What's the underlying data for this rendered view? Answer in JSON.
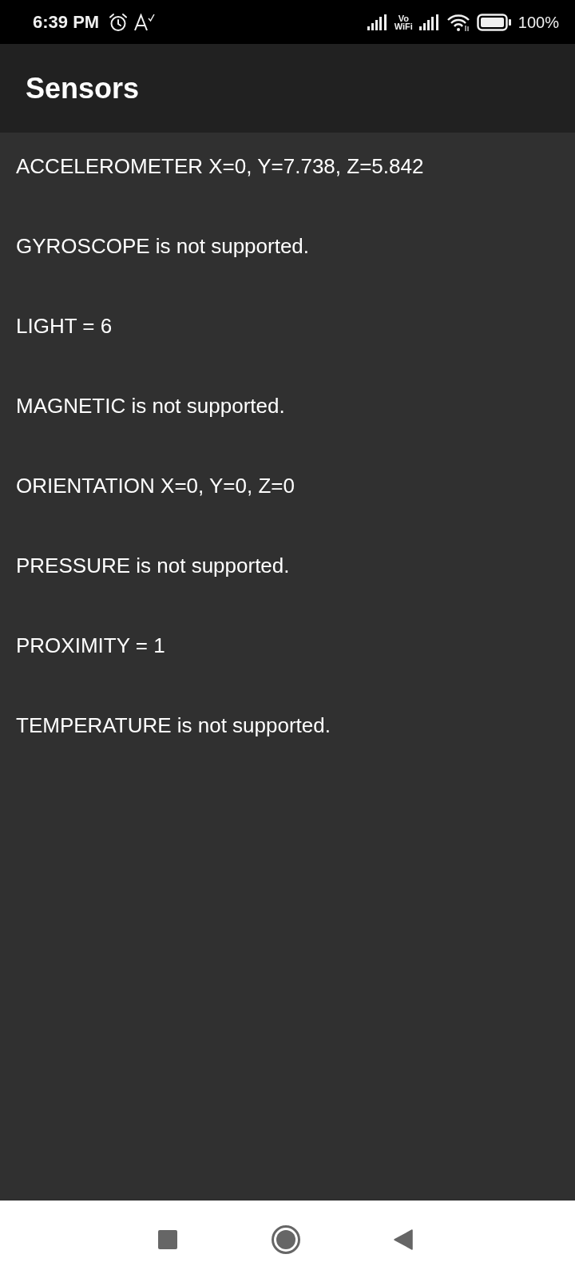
{
  "status_bar": {
    "time": "6:39 PM",
    "vowifi": [
      "Vo",
      "WiFi"
    ],
    "battery": "100%"
  },
  "app_bar": {
    "title": "Sensors"
  },
  "sensor_lines": [
    "ACCELEROMETER X=0, Y=7.738, Z=5.842",
    "GYROSCOPE is not supported.",
    "LIGHT = 6",
    "MAGNETIC is not supported.",
    "ORIENTATION X=0, Y=0, Z=0",
    "PRESSURE is not supported.",
    "PROXIMITY = 1",
    "TEMPERATURE is not supported."
  ]
}
